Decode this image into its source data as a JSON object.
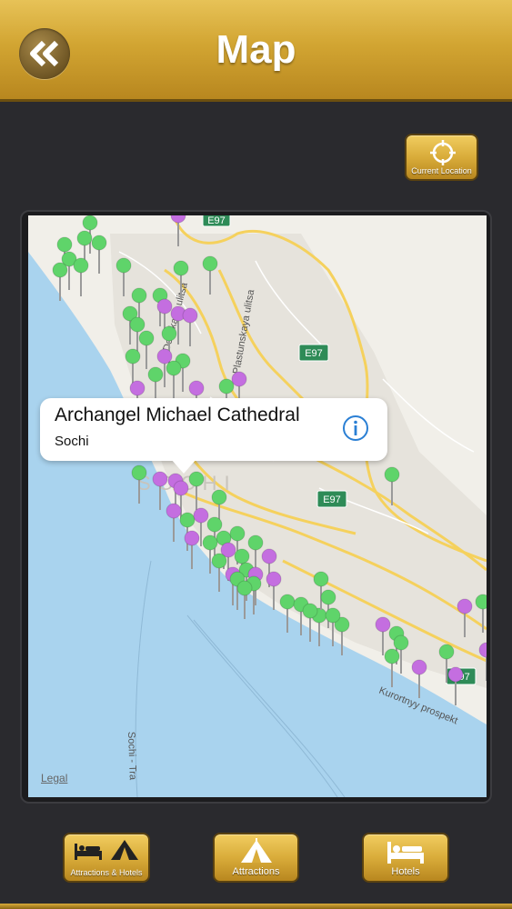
{
  "header": {
    "title": "Map",
    "back_icon": "double-chevron-left-icon"
  },
  "current_location": {
    "label": "Current Location",
    "icon": "crosshair-icon"
  },
  "map": {
    "road_labels": [
      "E97",
      "E97",
      "E97",
      "E97",
      "Plastunskaya ulitsa",
      "Donskaya ulitsa",
      "Kurortnyy prospekt",
      "Sochi - Tra",
      "SOCHI"
    ],
    "callout": {
      "title": "Archangel Michael Cathedral",
      "subtitle": "Sochi",
      "info_icon": "info-icon"
    },
    "legal": "Legal",
    "pin_colors": {
      "attraction": "#5fd46a",
      "hotel": "#c46ee0"
    }
  },
  "tabs": [
    {
      "label": "Attractions & Hotels",
      "icon": "bed-and-tent-icon"
    },
    {
      "label": "Attractions",
      "icon": "tent-icon"
    },
    {
      "label": "Hotels",
      "icon": "bed-icon"
    }
  ],
  "colors": {
    "gold": "#d2a532",
    "background": "#2a2a2e",
    "sea": "#a9d3ee"
  }
}
